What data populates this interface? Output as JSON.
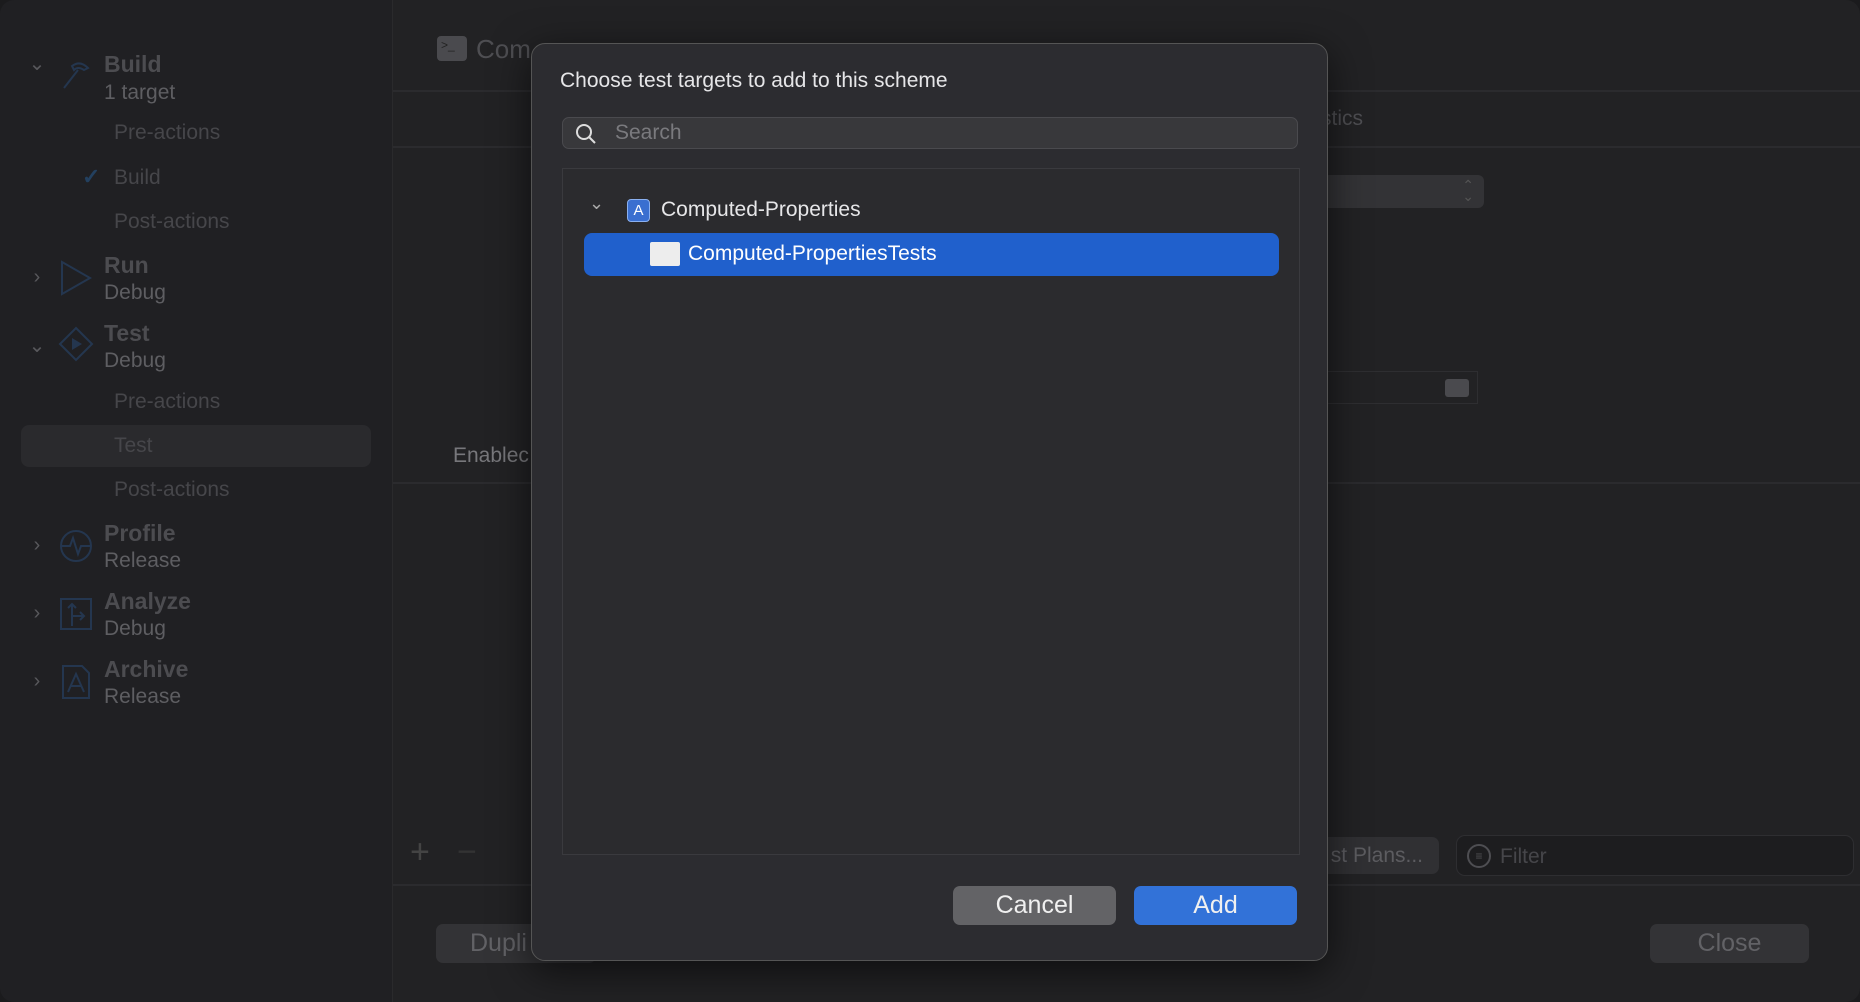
{
  "sidebar": {
    "groups": [
      {
        "title": "Build",
        "subtitle": "1 target",
        "icon": "hammer-icon",
        "expanded": true,
        "items": [
          {
            "label": "Pre-actions"
          },
          {
            "label": "Build",
            "checked": true
          },
          {
            "label": "Post-actions"
          }
        ]
      },
      {
        "title": "Run",
        "subtitle": "Debug",
        "icon": "play-icon",
        "expanded": false
      },
      {
        "title": "Test",
        "subtitle": "Debug",
        "icon": "test-diamond-icon",
        "expanded": true,
        "items": [
          {
            "label": "Pre-actions"
          },
          {
            "label": "Test",
            "selected": true
          },
          {
            "label": "Post-actions"
          }
        ]
      },
      {
        "title": "Profile",
        "subtitle": "Release",
        "icon": "instruments-icon",
        "expanded": false
      },
      {
        "title": "Analyze",
        "subtitle": "Debug",
        "icon": "analyze-icon",
        "expanded": false
      },
      {
        "title": "Archive",
        "subtitle": "Release",
        "icon": "archive-app-icon",
        "expanded": false
      }
    ]
  },
  "main": {
    "scheme_title_partial": "Com",
    "tab_partial": "stics",
    "enabled_label_partial": "Enablec",
    "test_plans_partial": "st Plans...",
    "filter_placeholder": "Filter",
    "duplicate_partial": "Dupli",
    "close_label": "Close"
  },
  "dialog": {
    "title": "Choose test targets to add to this scheme",
    "search_placeholder": "Search",
    "tree": {
      "project": "Computed-Properties",
      "targets": [
        {
          "label": "Computed-PropertiesTests",
          "selected": true
        }
      ]
    },
    "cancel_label": "Cancel",
    "add_label": "Add"
  },
  "colors": {
    "accent": "#2060cc",
    "add_button": "#3272d8",
    "cancel_button": "#636366"
  }
}
